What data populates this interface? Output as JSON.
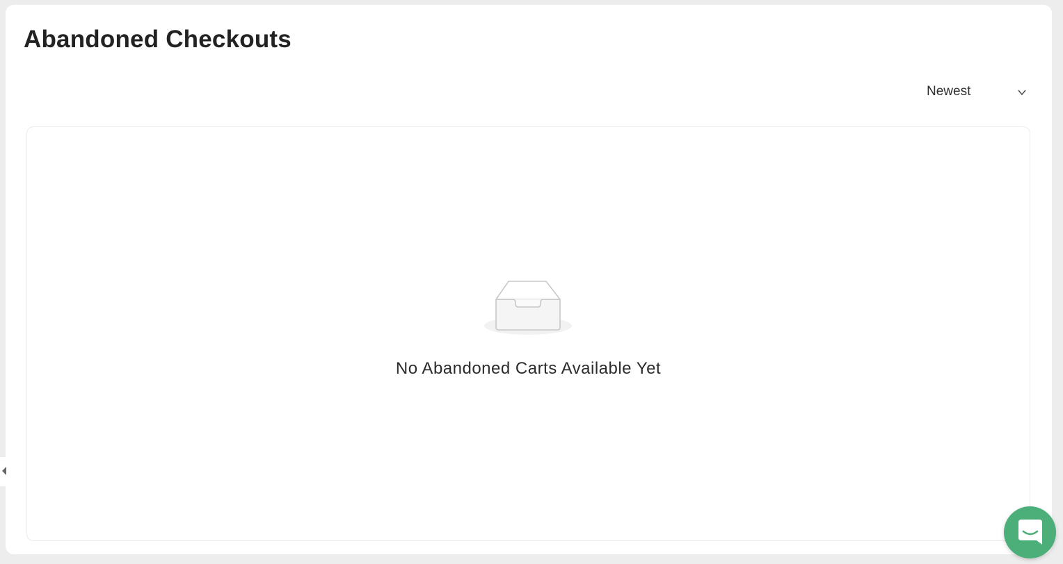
{
  "page": {
    "title": "Abandoned Checkouts"
  },
  "sort": {
    "selected": "Newest",
    "icon": "chevron-down-icon"
  },
  "empty_state": {
    "icon": "empty-inbox-icon",
    "message": "No Abandoned Carts Available Yet"
  },
  "sidebar_toggle": {
    "icon": "caret-left-icon"
  },
  "chat": {
    "icon": "chat-icon",
    "color": "#4caf7a"
  },
  "colors": {
    "background": "#ededed",
    "card": "#ffffff",
    "text": "#222222"
  }
}
